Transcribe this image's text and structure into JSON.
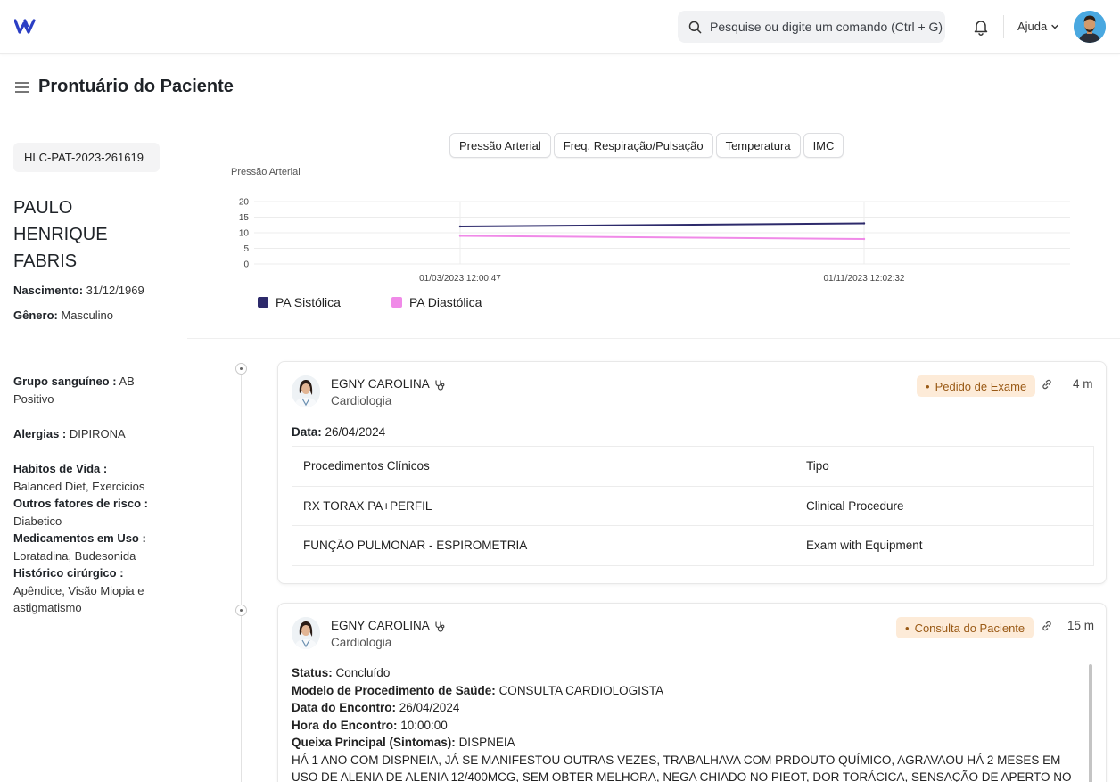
{
  "header": {
    "search_placeholder": "Pesquise ou digite um comando (Ctrl + G)",
    "help_label": "Ajuda",
    "brand_color": "#2b3ec4"
  },
  "page": {
    "title": "Prontuário do Paciente"
  },
  "patient": {
    "id": "HLC-PAT-2023-261619",
    "name_lines": [
      "PAULO",
      "HENRIQUE",
      "FABRIS"
    ],
    "birth_label": "Nascimento:",
    "birth_value": "31/12/1969",
    "gender_label": "Gênero:",
    "gender_value": "Masculino",
    "blood_label": "Grupo sanguíneo :",
    "blood_value": "AB Positivo",
    "allergy_label": "Alergias :",
    "allergy_value": "DIPIRONA",
    "habits_label": "Habitos de Vida :",
    "habits_value": "Balanced Diet, Exercicios",
    "risk_label": "Outros fatores de risco :",
    "risk_value": "Diabetico",
    "meds_label": "Medicamentos em Uso :",
    "meds_value": "Loratadina, Budesonida",
    "surgery_label": "Histórico cirúrgico :",
    "surgery_value": "Apêndice, Visão Miopia e astigmatismo"
  },
  "chart_tabs": [
    "Pressão Arterial",
    "Freq. Respiração/Pulsação",
    "Temperatura",
    "IMC"
  ],
  "chart_data": {
    "type": "line",
    "title": "Pressão Arterial",
    "x": [
      "01/03/2023 12:00:47",
      "01/11/2023 12:02:32"
    ],
    "series": [
      {
        "name": "PA Sistólica",
        "values": [
          12,
          13
        ],
        "color": "#2d2a6b"
      },
      {
        "name": "PA Diastólica",
        "values": [
          9,
          8
        ],
        "color": "#f08ae8"
      }
    ],
    "yticks": [
      20,
      15,
      10,
      5,
      0
    ],
    "ylim": [
      0,
      20
    ],
    "grid": true,
    "legend": "bottom-left"
  },
  "cards": [
    {
      "doctor": "EGNY CAROLINA",
      "specialty": "Cardiologia",
      "badge": "Pedido de Exame",
      "time": "4 m",
      "date_label": "Data:",
      "date_value": "26/04/2024",
      "table": [
        [
          "Procedimentos Clínicos",
          "Tipo"
        ],
        [
          "RX TORAX PA+PERFIL",
          "Clinical Procedure"
        ],
        [
          "FUNÇÃO PULMONAR - ESPIROMETRIA",
          "Exam with Equipment"
        ]
      ]
    },
    {
      "doctor": "EGNY CAROLINA",
      "specialty": "Cardiologia",
      "badge": "Consulta do Paciente",
      "time": "15 m",
      "status_label": "Status:",
      "status_value": "Concluído",
      "model_label": "Modelo de Procedimento de Saúde:",
      "model_value": "CONSULTA CARDIOLOGISTA",
      "enc_date_label": "Data do Encontro:",
      "enc_date_value": "26/04/2024",
      "enc_time_label": "Hora do Encontro:",
      "enc_time_value": "10:00:00",
      "complaint_label": "Queixa Principal (Sintomas):",
      "complaint_value": "DISPNEIA",
      "description": "HÁ 1 ANO COM DISPNEIA, JÁ SE MANIFESTOU OUTRAS VEZES, TRABALHAVA COM PRDOUTO QUÍMICO, AGRAVAOU HÁ 2 MESES EM USO DE ALENIA DE ALENIA 12/400MCG, SEM OBTER MELHORA, NEGA CHIADO NO PIEOT, DOR TORÁCICA, SENSAÇÃO DE APERTO NO PEITO, PRURIDO"
    }
  ]
}
